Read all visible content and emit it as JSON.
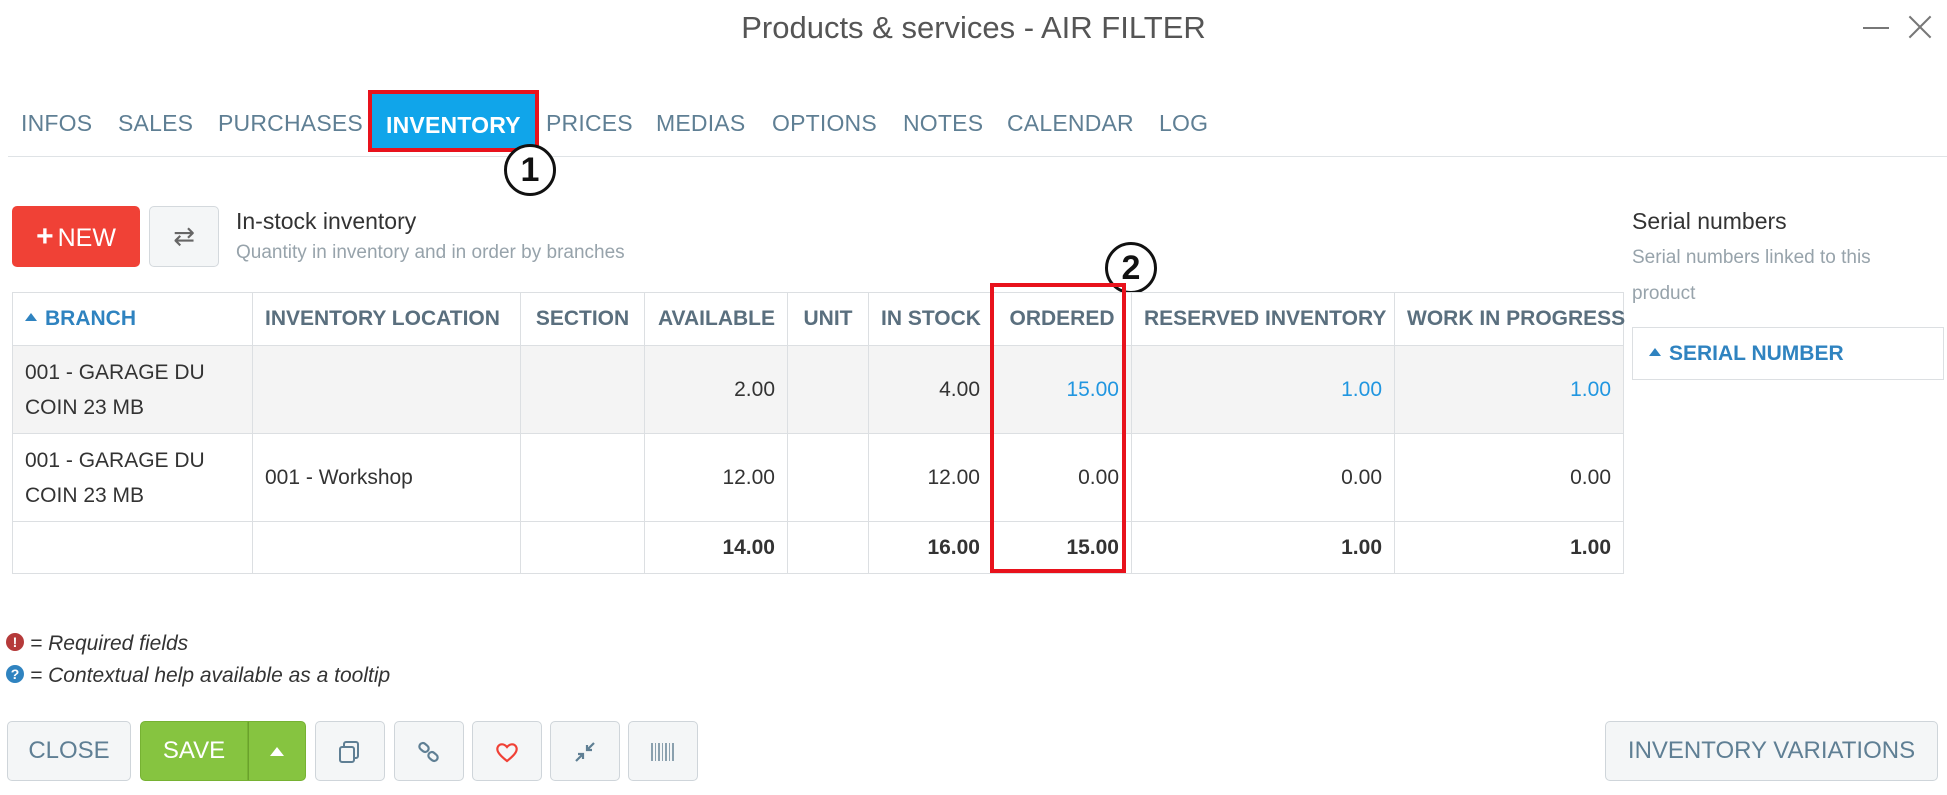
{
  "window": {
    "title": "Products & services - AIR FILTER"
  },
  "tabs": [
    "INFOS",
    "SALES",
    "PURCHASES",
    "INVENTORY",
    "PRICES",
    "MEDIAS",
    "OPTIONS",
    "NOTES",
    "CALENDAR",
    "LOG"
  ],
  "active_tab": "INVENTORY",
  "markers": [
    "1",
    "2"
  ],
  "toolbar": {
    "new_label": "NEW"
  },
  "inventory": {
    "title": "In-stock inventory",
    "subtitle": "Quantity in inventory and in order by branches",
    "columns": [
      "BRANCH",
      "INVENTORY LOCATION",
      "SECTION",
      "AVAILABLE",
      "UNIT",
      "IN STOCK",
      "ORDERED",
      "RESERVED INVENTORY",
      "WORK IN PROGRESS"
    ],
    "rows": [
      {
        "branch_line1": "001 - GARAGE DU",
        "branch_line2": "COIN 23 MB",
        "location": "",
        "section": "",
        "available": "2.00",
        "unit": "",
        "in_stock": "4.00",
        "ordered": "15.00",
        "reserved": "1.00",
        "wip": "1.00"
      },
      {
        "branch_line1": "001 - GARAGE DU",
        "branch_line2": "COIN 23 MB",
        "location": "001 - Workshop",
        "section": "",
        "available": "12.00",
        "unit": "",
        "in_stock": "12.00",
        "ordered": "0.00",
        "reserved": "0.00",
        "wip": "0.00"
      }
    ],
    "totals": {
      "available": "14.00",
      "in_stock": "16.00",
      "ordered": "15.00",
      "reserved": "1.00",
      "wip": "1.00"
    }
  },
  "serials": {
    "title": "Serial numbers",
    "subtitle": "Serial numbers linked to this product",
    "column": "SERIAL NUMBER"
  },
  "legend": {
    "required": "= Required fields",
    "help": "= Contextual help available as a tooltip"
  },
  "footer": {
    "close": "CLOSE",
    "save": "SAVE",
    "inventory_variations": "INVENTORY VARIATIONS"
  },
  "colors": {
    "accent": "#10a5ea",
    "danger": "#f04136",
    "success": "#86c440",
    "highlight": "#e8121c",
    "link": "#2196e0"
  }
}
